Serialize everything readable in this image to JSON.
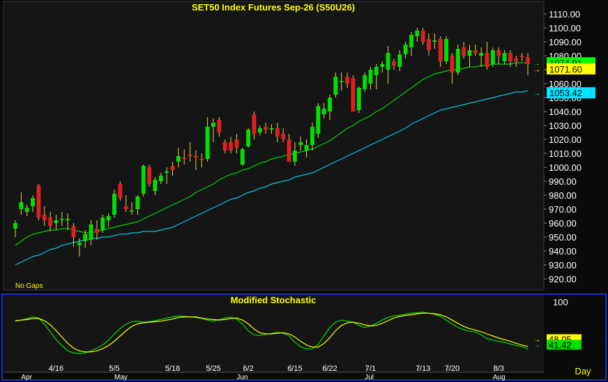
{
  "chart_data": [
    {
      "type": "candlestick",
      "title": "SET50  Index  Futures  Sep-26  (S50U26)",
      "note": "No  Gaps",
      "ylim": [
        915,
        1115
      ],
      "y_ticks": [
        "920.00",
        "930.00",
        "940.00",
        "950.00",
        "960.00",
        "970.00",
        "980.00",
        "990.00",
        "1000.00",
        "1010.00",
        "1020.00",
        "1030.00",
        "1040.00",
        "1050.00",
        "1060.00",
        "1070.00",
        "1080.00",
        "1090.00",
        "1100.00",
        "1110.00"
      ],
      "candles": [
        {
          "o": 956,
          "h": 962,
          "l": 950,
          "c": 960
        },
        {
          "o": 970,
          "h": 982,
          "l": 966,
          "c": 975
        },
        {
          "o": 968,
          "h": 973,
          "l": 965,
          "c": 971
        },
        {
          "o": 972,
          "h": 980,
          "l": 968,
          "c": 978
        },
        {
          "o": 987,
          "h": 988,
          "l": 962,
          "c": 964
        },
        {
          "o": 966,
          "h": 972,
          "l": 958,
          "c": 962
        },
        {
          "o": 964,
          "h": 968,
          "l": 954,
          "c": 958
        },
        {
          "o": 960,
          "h": 966,
          "l": 955,
          "c": 962
        },
        {
          "o": 963,
          "h": 968,
          "l": 958,
          "c": 963
        },
        {
          "o": 962,
          "h": 967,
          "l": 955,
          "c": 963
        },
        {
          "o": 958,
          "h": 960,
          "l": 943,
          "c": 950
        },
        {
          "o": 944,
          "h": 949,
          "l": 936,
          "c": 946
        },
        {
          "o": 947,
          "h": 955,
          "l": 942,
          "c": 952
        },
        {
          "o": 948,
          "h": 962,
          "l": 944,
          "c": 959
        },
        {
          "o": 956,
          "h": 962,
          "l": 948,
          "c": 953
        },
        {
          "o": 955,
          "h": 966,
          "l": 953,
          "c": 964
        },
        {
          "o": 962,
          "h": 967,
          "l": 957,
          "c": 965
        },
        {
          "o": 966,
          "h": 984,
          "l": 964,
          "c": 981
        },
        {
          "o": 988,
          "h": 990,
          "l": 976,
          "c": 978
        },
        {
          "o": 972,
          "h": 980,
          "l": 968,
          "c": 970
        },
        {
          "o": 969,
          "h": 975,
          "l": 966,
          "c": 969
        },
        {
          "o": 970,
          "h": 980,
          "l": 966,
          "c": 979
        },
        {
          "o": 981,
          "h": 1002,
          "l": 979,
          "c": 1001
        },
        {
          "o": 1000,
          "h": 1002,
          "l": 986,
          "c": 988
        },
        {
          "o": 983,
          "h": 993,
          "l": 980,
          "c": 991
        },
        {
          "o": 990,
          "h": 996,
          "l": 988,
          "c": 994
        },
        {
          "o": 996,
          "h": 1000,
          "l": 988,
          "c": 997
        },
        {
          "o": 1001,
          "h": 1004,
          "l": 994,
          "c": 998
        },
        {
          "o": 1004,
          "h": 1014,
          "l": 1000,
          "c": 1008
        },
        {
          "o": 1007,
          "h": 1013,
          "l": 1002,
          "c": 1006
        },
        {
          "o": 1009,
          "h": 1018,
          "l": 1004,
          "c": 1008
        },
        {
          "o": 1008,
          "h": 1012,
          "l": 998,
          "c": 1007
        },
        {
          "o": 1006,
          "h": 1010,
          "l": 1000,
          "c": 1005
        },
        {
          "o": 1006,
          "h": 1036,
          "l": 1004,
          "c": 1029
        },
        {
          "o": 1029,
          "h": 1035,
          "l": 1018,
          "c": 1032
        },
        {
          "o": 1034,
          "h": 1036,
          "l": 1022,
          "c": 1025
        },
        {
          "o": 1018,
          "h": 1020,
          "l": 1010,
          "c": 1012
        },
        {
          "o": 1018,
          "h": 1022,
          "l": 1010,
          "c": 1012
        },
        {
          "o": 1020,
          "h": 1024,
          "l": 1010,
          "c": 1014
        },
        {
          "o": 1002,
          "h": 1014,
          "l": 1001,
          "c": 1013
        },
        {
          "o": 1015,
          "h": 1028,
          "l": 1014,
          "c": 1027
        },
        {
          "o": 1038,
          "h": 1040,
          "l": 1020,
          "c": 1024
        },
        {
          "o": 1025,
          "h": 1030,
          "l": 1023,
          "c": 1028
        },
        {
          "o": 1029,
          "h": 1032,
          "l": 1024,
          "c": 1027
        },
        {
          "o": 1027,
          "h": 1031,
          "l": 1024,
          "c": 1028
        },
        {
          "o": 1028,
          "h": 1032,
          "l": 1018,
          "c": 1022
        },
        {
          "o": 1024,
          "h": 1028,
          "l": 1018,
          "c": 1020
        },
        {
          "o": 1020,
          "h": 1024,
          "l": 1004,
          "c": 1004
        },
        {
          "o": 1004,
          "h": 1018,
          "l": 1001,
          "c": 1012
        },
        {
          "o": 1016,
          "h": 1022,
          "l": 1012,
          "c": 1018
        },
        {
          "o": 1012,
          "h": 1020,
          "l": 1007,
          "c": 1016
        },
        {
          "o": 1016,
          "h": 1032,
          "l": 1012,
          "c": 1029
        },
        {
          "o": 1024,
          "h": 1046,
          "l": 1021,
          "c": 1044
        },
        {
          "o": 1038,
          "h": 1046,
          "l": 1035,
          "c": 1042
        },
        {
          "o": 1040,
          "h": 1052,
          "l": 1034,
          "c": 1050
        },
        {
          "o": 1052,
          "h": 1068,
          "l": 1050,
          "c": 1065
        },
        {
          "o": 1062,
          "h": 1068,
          "l": 1055,
          "c": 1062
        },
        {
          "o": 1065,
          "h": 1068,
          "l": 1057,
          "c": 1060
        },
        {
          "o": 1064,
          "h": 1066,
          "l": 1040,
          "c": 1040
        },
        {
          "o": 1041,
          "h": 1058,
          "l": 1039,
          "c": 1057
        },
        {
          "o": 1056,
          "h": 1068,
          "l": 1054,
          "c": 1066
        },
        {
          "o": 1060,
          "h": 1072,
          "l": 1056,
          "c": 1070
        },
        {
          "o": 1066,
          "h": 1074,
          "l": 1056,
          "c": 1072
        },
        {
          "o": 1072,
          "h": 1076,
          "l": 1068,
          "c": 1074
        },
        {
          "o": 1070,
          "h": 1087,
          "l": 1060,
          "c": 1082
        },
        {
          "o": 1076,
          "h": 1078,
          "l": 1070,
          "c": 1073
        },
        {
          "o": 1072,
          "h": 1084,
          "l": 1069,
          "c": 1081
        },
        {
          "o": 1081,
          "h": 1090,
          "l": 1078,
          "c": 1088
        },
        {
          "o": 1086,
          "h": 1097,
          "l": 1080,
          "c": 1095
        },
        {
          "o": 1094,
          "h": 1100,
          "l": 1090,
          "c": 1098
        },
        {
          "o": 1098,
          "h": 1100,
          "l": 1088,
          "c": 1090
        },
        {
          "o": 1092,
          "h": 1096,
          "l": 1080,
          "c": 1084
        },
        {
          "o": 1090,
          "h": 1096,
          "l": 1085,
          "c": 1091
        },
        {
          "o": 1092,
          "h": 1094,
          "l": 1072,
          "c": 1076
        },
        {
          "o": 1076,
          "h": 1094,
          "l": 1074,
          "c": 1092
        },
        {
          "o": 1080,
          "h": 1082,
          "l": 1060,
          "c": 1068
        },
        {
          "o": 1068,
          "h": 1088,
          "l": 1066,
          "c": 1085
        },
        {
          "o": 1086,
          "h": 1090,
          "l": 1078,
          "c": 1080
        },
        {
          "o": 1080,
          "h": 1088,
          "l": 1072,
          "c": 1084
        },
        {
          "o": 1084,
          "h": 1088,
          "l": 1080,
          "c": 1082
        },
        {
          "o": 1080,
          "h": 1086,
          "l": 1072,
          "c": 1082
        },
        {
          "o": 1082,
          "h": 1090,
          "l": 1070,
          "c": 1072
        },
        {
          "o": 1074,
          "h": 1086,
          "l": 1072,
          "c": 1084
        },
        {
          "o": 1084,
          "h": 1086,
          "l": 1074,
          "c": 1080
        },
        {
          "o": 1076,
          "h": 1084,
          "l": 1074,
          "c": 1082
        },
        {
          "o": 1082,
          "h": 1084,
          "l": 1072,
          "c": 1076
        },
        {
          "o": 1078,
          "h": 1080,
          "l": 1072,
          "c": 1076
        },
        {
          "o": 1080,
          "h": 1082,
          "l": 1076,
          "c": 1079
        },
        {
          "o": 1079,
          "h": 1082,
          "l": 1066,
          "c": 1074
        }
      ],
      "ma_short": [
        944,
        947,
        950,
        952,
        953,
        954,
        955,
        955,
        956,
        956,
        955,
        954,
        953,
        953,
        954,
        955,
        956,
        957,
        958,
        959,
        960,
        961,
        963,
        965,
        967,
        969,
        971,
        973,
        975,
        977,
        979,
        982,
        984,
        986,
        988,
        991,
        993,
        995,
        996,
        998,
        999,
        1001,
        1003,
        1004,
        1006,
        1007,
        1008,
        1009,
        1010,
        1011,
        1012,
        1013,
        1015,
        1017,
        1019,
        1022,
        1025,
        1028,
        1030,
        1033,
        1035,
        1037,
        1040,
        1042,
        1045,
        1048,
        1051,
        1054,
        1057,
        1060,
        1063,
        1065,
        1067,
        1068,
        1069,
        1070,
        1070,
        1071,
        1072,
        1072,
        1073,
        1073,
        1074,
        1074,
        1074,
        1074,
        1075,
        1075,
        1075
      ],
      "ma_long": [
        930,
        932,
        934,
        936,
        937,
        939,
        941,
        942,
        944,
        945,
        946,
        947,
        948,
        949,
        949,
        950,
        950,
        951,
        952,
        952,
        953,
        953,
        954,
        954,
        954,
        955,
        956,
        957,
        959,
        961,
        963,
        965,
        967,
        969,
        971,
        973,
        975,
        977,
        978,
        980,
        982,
        983,
        985,
        986,
        988,
        989,
        990,
        991,
        993,
        994,
        995,
        996,
        998,
        1000,
        1002,
        1004,
        1006,
        1008,
        1010,
        1012,
        1014,
        1016,
        1018,
        1020,
        1022,
        1024,
        1026,
        1028,
        1031,
        1033,
        1035,
        1037,
        1039,
        1041,
        1042,
        1043,
        1044,
        1045,
        1046,
        1047,
        1048,
        1049,
        1050,
        1051,
        1052,
        1053,
        1054,
        1054,
        1055
      ],
      "price_labels": [
        {
          "value": 1074.91,
          "text": "1074.91",
          "color": "#00ff00"
        },
        {
          "value": 1071.6,
          "text": "1071.60",
          "color": "#ffff00"
        },
        {
          "value": 1053.42,
          "text": "1053.42",
          "color": "#00e5ff"
        }
      ],
      "colors": {
        "up": "#00e000",
        "down": "#e02020",
        "ma_short": "#00d000",
        "ma_long": "#00c8e0",
        "title": "#ffff00"
      }
    },
    {
      "type": "line",
      "title": "Modified  Stochastic",
      "ylim": [
        0,
        100
      ],
      "y_ticks": [
        "100"
      ],
      "series": [
        {
          "color": "#00e000",
          "values": [
            78,
            80,
            83,
            86,
            84,
            72,
            58,
            43,
            32,
            22,
            18,
            17,
            18,
            22,
            27,
            33,
            42,
            54,
            64,
            72,
            77,
            78,
            76,
            77,
            79,
            81,
            84,
            86,
            88,
            87,
            86,
            85,
            83,
            80,
            78,
            81,
            84,
            86,
            82,
            72,
            60,
            52,
            51,
            53,
            55,
            57,
            55,
            50,
            38,
            30,
            25,
            26,
            34,
            50,
            66,
            76,
            80,
            78,
            76,
            70,
            66,
            69,
            74,
            80,
            85,
            88,
            89,
            91,
            93,
            94,
            95,
            93,
            91,
            87,
            80,
            73,
            66,
            62,
            59,
            58,
            52,
            45,
            42,
            40,
            38,
            35,
            32,
            30,
            25
          ]
        },
        {
          "color": "#ffff00",
          "values": [
            79,
            80,
            81,
            83,
            83,
            79,
            71,
            60,
            48,
            36,
            27,
            22,
            20,
            20,
            22,
            26,
            32,
            40,
            50,
            60,
            68,
            73,
            75,
            76,
            77,
            78,
            80,
            82,
            85,
            86,
            86,
            86,
            84,
            82,
            81,
            80,
            81,
            83,
            84,
            80,
            73,
            63,
            56,
            54,
            54,
            55,
            56,
            54,
            48,
            40,
            33,
            29,
            29,
            36,
            47,
            60,
            70,
            75,
            76,
            74,
            71,
            69,
            70,
            74,
            79,
            84,
            87,
            89,
            90,
            92,
            93,
            93,
            92,
            90,
            86,
            80,
            74,
            68,
            64,
            61,
            58,
            54,
            50,
            46,
            43,
            40,
            36,
            33,
            30
          ]
        }
      ],
      "value_labels": [
        {
          "value": 48.05,
          "text": "48.05",
          "color": "#ffff00"
        },
        {
          "value": 41.42,
          "text": "41.42",
          "color": "#00e000"
        }
      ]
    }
  ],
  "date_axis": {
    "month_labels": [
      {
        "index": 1,
        "text": "Apr"
      },
      {
        "index": 17,
        "text": "May"
      },
      {
        "index": 38,
        "text": "Jun"
      },
      {
        "index": 60,
        "text": "Jul"
      },
      {
        "index": 82,
        "text": "Aug"
      }
    ],
    "day_labels": [
      {
        "index": 7,
        "text": "4/16"
      },
      {
        "index": 17,
        "text": "5/5"
      },
      {
        "index": 27,
        "text": "5/18"
      },
      {
        "index": 34,
        "text": "5/25"
      },
      {
        "index": 40,
        "text": "6/2"
      },
      {
        "index": 48,
        "text": "6/15"
      },
      {
        "index": 54,
        "text": "6/22"
      },
      {
        "index": 61,
        "text": "7/1"
      },
      {
        "index": 70,
        "text": "7/13"
      },
      {
        "index": 75,
        "text": "7/20"
      },
      {
        "index": 83,
        "text": "8/3"
      }
    ],
    "period": "Day"
  }
}
